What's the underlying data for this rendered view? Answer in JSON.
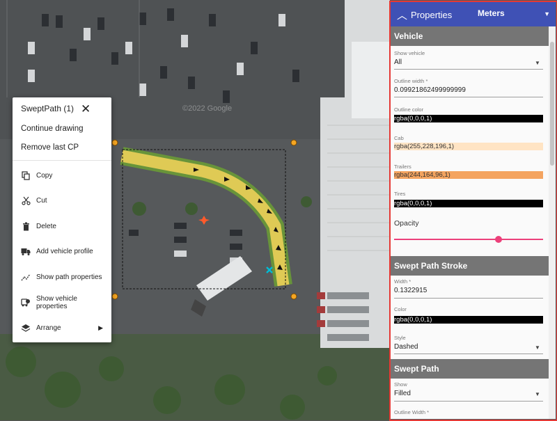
{
  "map": {
    "watermark": "©2022 Google"
  },
  "context_menu": {
    "title": "SweptPath (1)",
    "close_icon": "close-icon",
    "actions": [
      {
        "label": "Continue drawing"
      },
      {
        "label": "Remove last CP"
      }
    ],
    "items": [
      {
        "label": "Copy",
        "icon": "copy-icon"
      },
      {
        "label": "Cut",
        "icon": "scissors-icon"
      },
      {
        "label": "Delete",
        "icon": "trash-icon"
      },
      {
        "label": "Add vehicle profile",
        "icon": "truck-icon"
      },
      {
        "label": "Show path properties",
        "icon": "path-icon"
      },
      {
        "label": "Show vehicle properties",
        "icon": "vehicle-icon"
      },
      {
        "label": "Arrange",
        "icon": "layers-icon",
        "submenu": true
      }
    ]
  },
  "properties": {
    "header": {
      "title": "Properties",
      "unit": "Meters"
    },
    "vehicle": {
      "title": "Vehicle",
      "show_vehicle": {
        "label": "Show vehicle",
        "value": "All"
      },
      "outline_width": {
        "label": "Outline width *",
        "value": "0.09921862499999999"
      },
      "outline_color": {
        "label": "Outline color",
        "value": "rgba(0,0,0,1)",
        "color": "#000000"
      },
      "cab": {
        "label": "Cab",
        "value": "rgba(255,228,196,1)",
        "color": "#ffe4c4"
      },
      "trailers": {
        "label": "Trailers",
        "value": "rgba(244,164,96,1)",
        "color": "#f4a460"
      },
      "tires": {
        "label": "Tires",
        "value": "rgba(0,0,0,1)",
        "color": "#000000"
      },
      "opacity": {
        "label": "Opacity",
        "value": 0.7
      }
    },
    "stroke": {
      "title": "Swept Path Stroke",
      "width": {
        "label": "Width *",
        "value": "0.1322915"
      },
      "color": {
        "label": "Color",
        "value": "rgba(0,0,0,1)",
        "color": "#000000"
      },
      "style": {
        "label": "Style",
        "value": "Dashed"
      }
    },
    "swept_path": {
      "title": "Swept Path",
      "show": {
        "label": "Show",
        "value": "Filled"
      },
      "outline_width": {
        "label": "Outline Width *"
      }
    }
  }
}
